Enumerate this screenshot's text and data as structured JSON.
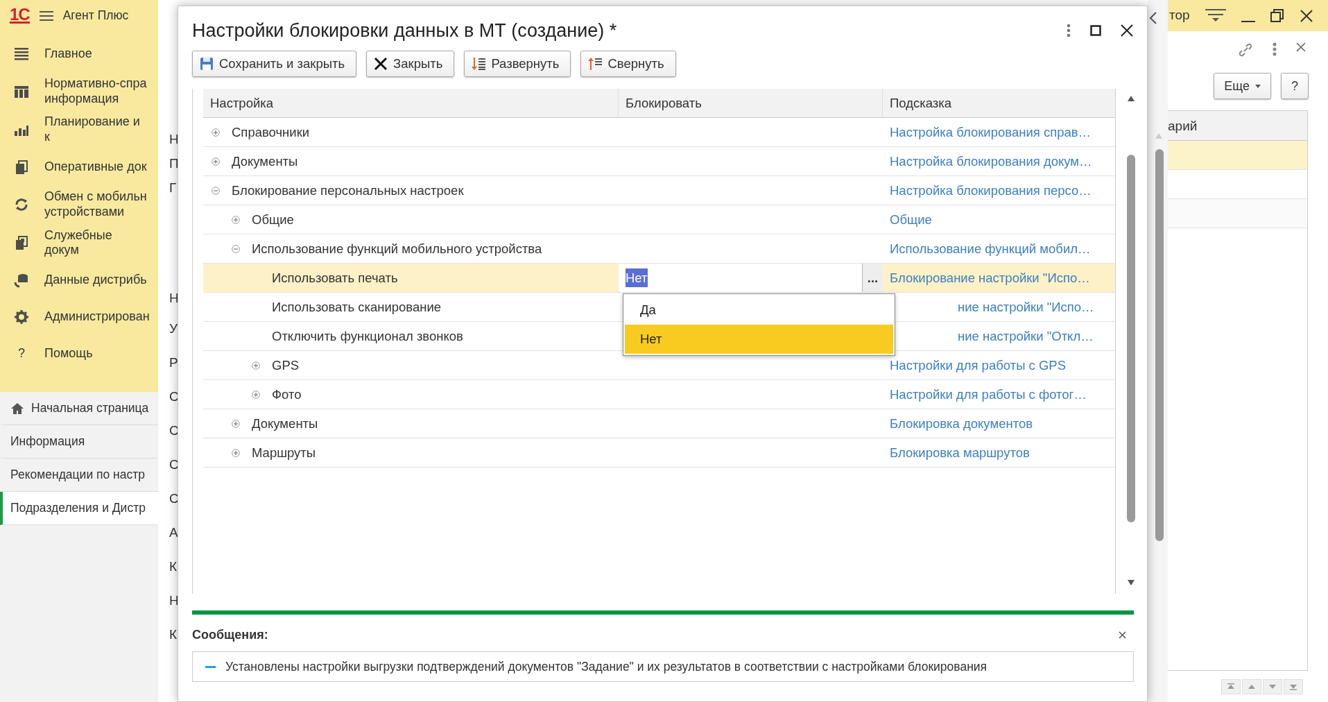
{
  "app_bar": {
    "logo": "1С",
    "title": "Агент Плюс",
    "user": "тор"
  },
  "sidebar": {
    "sections": [
      {
        "label": "Главное"
      },
      {
        "label": "Нормативно-спра информация"
      },
      {
        "label": "Планирование и к"
      },
      {
        "label": "Оперативные док"
      },
      {
        "label": "Обмен с мобильн устройствами"
      },
      {
        "label": "Служебные докум"
      },
      {
        "label": "Данные дистрибь"
      },
      {
        "label": "Администрирован"
      },
      {
        "label": "Помощь",
        "glyph": "?"
      }
    ],
    "pages": [
      {
        "label": "Начальная страница",
        "kind": "home",
        "selected": false
      },
      {
        "label": "Информация",
        "kind": "page",
        "selected": false
      },
      {
        "label": "Рекомендации по настр",
        "kind": "page",
        "selected": false
      },
      {
        "label": "Подразделения и Дистр",
        "kind": "page",
        "selected": true
      }
    ]
  },
  "background_form": {
    "label_fragments": [
      "Н",
      "П",
      "Г",
      "Н",
      "У",
      "Р",
      "С",
      "С",
      "С",
      "С",
      "А",
      "К",
      "Н",
      "К"
    ]
  },
  "right_panel": {
    "column_fragment": "арий",
    "more_button": "Еще",
    "help_button": "?",
    "rows": [
      {
        "selected": true
      },
      {
        "selected": false
      },
      {
        "selected": false
      }
    ]
  },
  "dialog": {
    "title": "Настройки блокировки данных в МТ (создание) *",
    "toolbar": [
      {
        "label": "Сохранить и закрыть",
        "kind": "save"
      },
      {
        "label": "Закрыть",
        "kind": "close"
      },
      {
        "label": "Развернуть",
        "kind": "expand"
      },
      {
        "label": "Свернуть",
        "kind": "collapse"
      }
    ],
    "table": {
      "columns": [
        "Настройка",
        "Блокировать",
        "Подсказка"
      ],
      "rows": [
        {
          "label": "Справочники",
          "hint": "Настройка блокирования справ…",
          "expanded": false,
          "selected": false
        },
        {
          "label": "Документы",
          "hint": "Настройка блокирования докум…",
          "expanded": false,
          "selected": false
        },
        {
          "label": "Блокирование персональных настроек",
          "hint": "Настройка блокирования персо…",
          "expanded": true,
          "selected": false,
          "children": [
            {
              "label": "Общие",
              "hint": "Общие",
              "expanded": false,
              "selected": false
            },
            {
              "label": "Использование функций мобильного устройства",
              "hint": "Использование функций мобил…",
              "expanded": true,
              "selected": false,
              "children": [
                {
                  "label": "Использовать печать",
                  "hint": "Блокирование настройки \"Испо…",
                  "selected": true,
                  "value": "Нет",
                  "choose_button": "...",
                  "dropdown": [
                    {
                      "label": "Да",
                      "selected": false
                    },
                    {
                      "label": "Нет",
                      "selected": true
                    }
                  ]
                },
                {
                  "label": "Использовать сканирование",
                  "hint": "ние настройки \"Испо…",
                  "selected": false
                },
                {
                  "label": "Отключить функционал звонков",
                  "hint": "ние настройки \"Откл…",
                  "selected": false
                },
                {
                  "label": "GPS",
                  "hint": "Настройки для работы с GPS",
                  "expanded": false,
                  "selected": false
                },
                {
                  "label": "Фото",
                  "hint": "Настройки для работы с фотог…",
                  "expanded": false,
                  "selected": false
                }
              ]
            },
            {
              "label": "Документы",
              "hint": "Блокировка документов",
              "expanded": false,
              "selected": false
            },
            {
              "label": "Маршруты",
              "hint": "Блокировка маршрутов",
              "expanded": false,
              "selected": false
            }
          ]
        }
      ]
    },
    "messages": {
      "title": "Сообщения:",
      "items": [
        "Установлены настройки выгрузки подтверждений документов \"Задание\" и их результатов в соответствии с настройками блокирования"
      ]
    }
  }
}
